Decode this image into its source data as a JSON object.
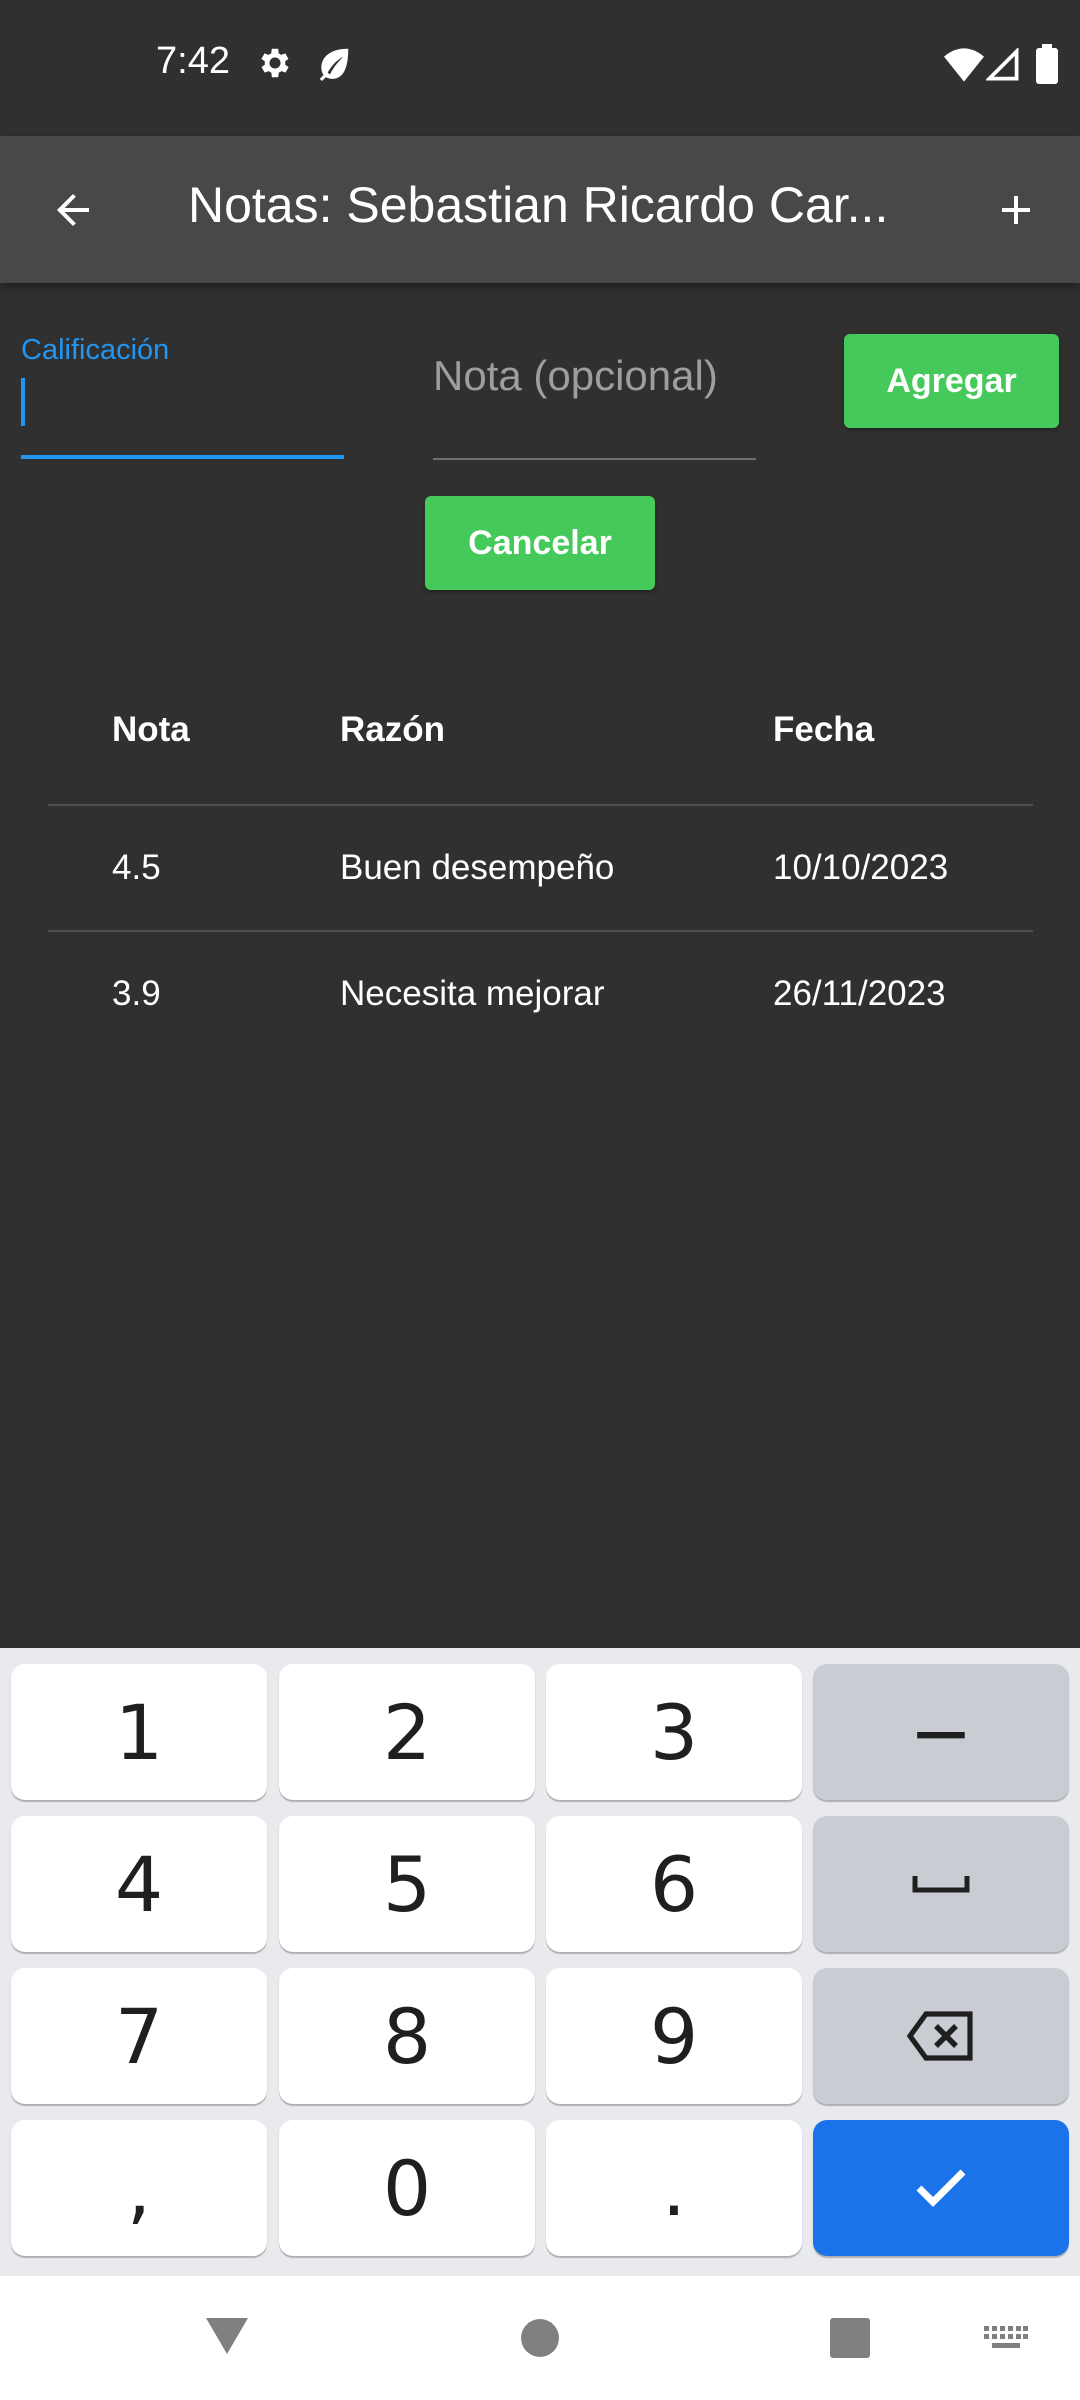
{
  "status_bar": {
    "time": "7:42",
    "icons": [
      "gear-icon",
      "leaf-icon",
      "wifi-icon",
      "signal-icon",
      "battery-icon"
    ]
  },
  "app_bar": {
    "title": "Notas: Sebastian Ricardo Car...",
    "back_icon": "arrow-left-icon",
    "add_icon": "plus-icon"
  },
  "form": {
    "calificacion_label": "Calificación",
    "nota_placeholder": "Nota (opcional)",
    "agregar_label": "Agregar",
    "cancelar_label": "Cancelar"
  },
  "table": {
    "headers": [
      "Nota",
      "Razón",
      "Fecha"
    ],
    "rows": [
      [
        "4.5",
        "Buen desempeño",
        "10/10/2023"
      ],
      [
        "3.9",
        "Necesita mejorar",
        "26/11/2023"
      ]
    ]
  },
  "keyboard": {
    "keys": [
      "1",
      "2",
      "3",
      "−",
      "4",
      "5",
      "6",
      "␣",
      "7",
      "8",
      "9",
      "⌫",
      ",",
      "0",
      ".",
      "✓"
    ]
  },
  "colors": {
    "background": "#303030",
    "app_bar": "#484848",
    "accent": "#2196f3",
    "button_green": "#45c95a",
    "keyboard_enter": "#1a73e8"
  }
}
